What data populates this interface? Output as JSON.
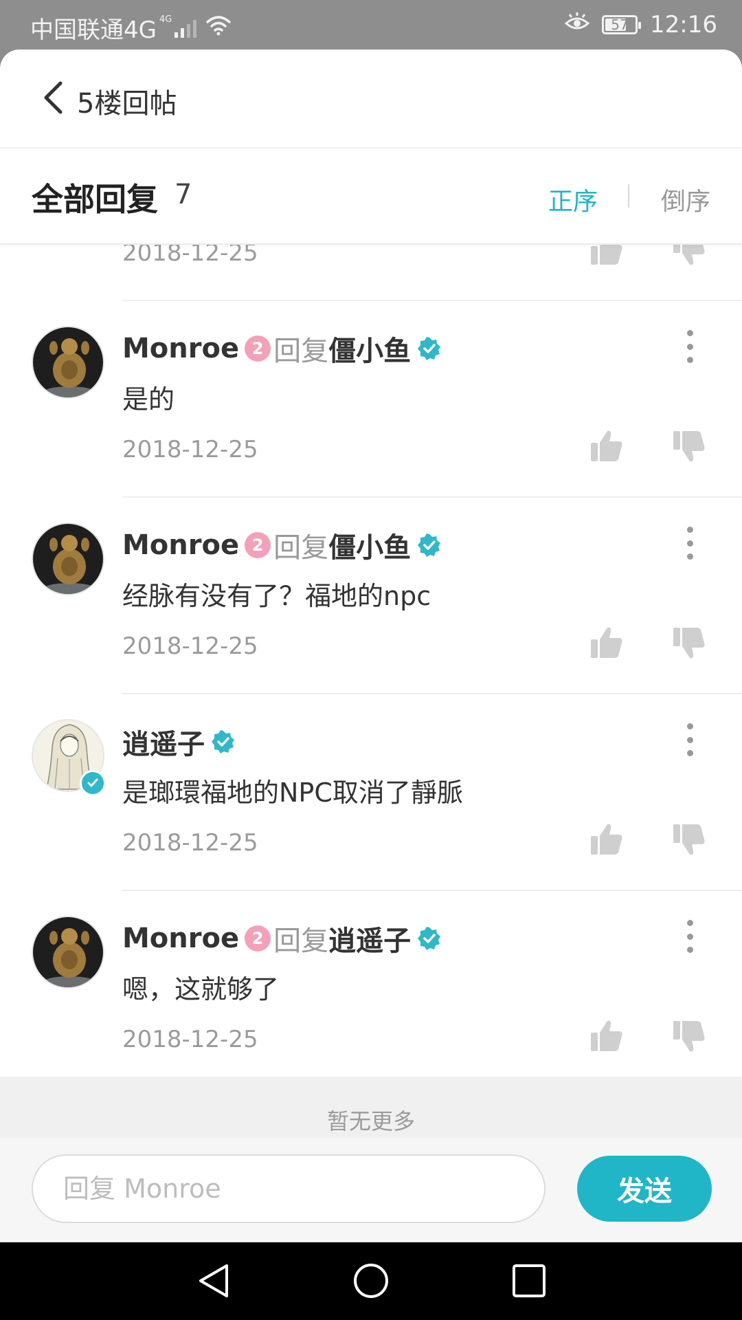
{
  "status_bar": {
    "carrier": "中国联通4G",
    "network_badge": "4G",
    "battery_level": "57",
    "time": "12:16"
  },
  "header": {
    "back_icon": "chevron-left-icon",
    "title": "5楼回帖"
  },
  "sort_bar": {
    "title": "全部回复",
    "count": "7",
    "asc_label": "正序",
    "desc_label": "倒序",
    "active_color": "#21b5c8"
  },
  "partial_reply": {
    "date": "2018-12-25"
  },
  "replies": [
    {
      "name": "Monroe",
      "level": "2",
      "reply_word": "回复",
      "target": "僵小鱼",
      "content": "是的",
      "date": "2018-12-25",
      "avatar": "golden-figure-avatar"
    },
    {
      "name": "Monroe",
      "level": "2",
      "reply_word": "回复",
      "target": "僵小鱼",
      "content": "经脉有没有了？福地的npc",
      "date": "2018-12-25",
      "avatar": "golden-figure-avatar"
    },
    {
      "name": "逍遥子",
      "level": "",
      "reply_word": "",
      "target": "",
      "content": "是瑯環福地的NPC取消了靜脈",
      "date": "2018-12-25",
      "avatar": "sketch-character-avatar"
    },
    {
      "name": "Monroe",
      "level": "2",
      "reply_word": "回复",
      "target": "逍遥子",
      "content": "嗯，这就够了",
      "date": "2018-12-25",
      "avatar": "golden-figure-avatar"
    }
  ],
  "footer": {
    "no_more": "暂无更多"
  },
  "input_bar": {
    "placeholder": "回复 Monroe",
    "send_label": "发送"
  },
  "colors": {
    "accent": "#21b5c8",
    "level_badge": "#f3a0b8"
  }
}
